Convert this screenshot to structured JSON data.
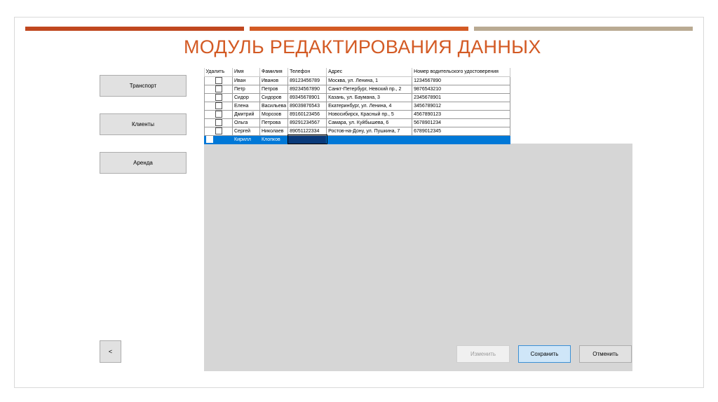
{
  "page": {
    "title": "МОДУЛЬ РЕДАКТИРОВАНИЯ ДАННЫХ",
    "stripe_colors": [
      "#c0471f",
      "#d35a24",
      "#b9aa92"
    ]
  },
  "sidebar": {
    "items": [
      {
        "label": "Транспорт"
      },
      {
        "label": "Клиенты"
      },
      {
        "label": "Аренда"
      }
    ],
    "back_label": "<"
  },
  "grid": {
    "columns": [
      "Удалить",
      "Имя",
      "Фамилия",
      "Телефон",
      "Адрес",
      "Номер водительского удостоверения"
    ],
    "rows": [
      {
        "delete": false,
        "name": "Иван",
        "surname": "Иванов",
        "phone": "89123456789",
        "address": "Москва, ул. Ленина, 1",
        "license": "1234567890"
      },
      {
        "delete": false,
        "name": "Петр",
        "surname": "Петров",
        "phone": "89234567890",
        "address": "Санкт-Петербург, Невский пр., 2",
        "license": "9876543210"
      },
      {
        "delete": false,
        "name": "Сидор",
        "surname": "Сидоров",
        "phone": "89345678901",
        "address": "Казань, ул. Баумана, 3",
        "license": "2345678901"
      },
      {
        "delete": false,
        "name": "Елена",
        "surname": "Васильева",
        "phone": "89039876543",
        "address": "Екатеринбург, ул. Ленина, 4",
        "license": "3456789012"
      },
      {
        "delete": false,
        "name": "Дмитрий",
        "surname": "Морозов",
        "phone": "89160123456",
        "address": "Новосибирск, Красный пр., 5",
        "license": "4567890123"
      },
      {
        "delete": false,
        "name": "Ольга",
        "surname": "Петрова",
        "phone": "89291234567",
        "address": "Самара, ул. Куйбышева, 6",
        "license": "5678901234"
      },
      {
        "delete": false,
        "name": "Сергей",
        "surname": "Николаев",
        "phone": "89051122334",
        "address": "Ростов-на-Дону, ул. Пушкина, 7",
        "license": "6789012345"
      }
    ],
    "new_row": {
      "name": "Кирилл",
      "surname": "Клопков",
      "phone": "",
      "address": "",
      "license": ""
    },
    "selection_color": "#0078d7"
  },
  "actions": {
    "edit_label": "Изменить",
    "save_label": "Сохранить",
    "cancel_label": "Отменить"
  }
}
